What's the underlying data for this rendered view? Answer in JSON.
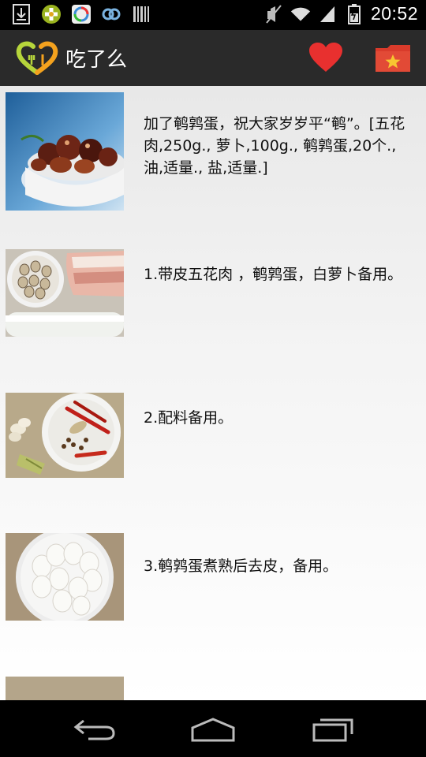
{
  "status_bar": {
    "time": "20:52",
    "icons": [
      "download-icon",
      "game-icon",
      "photos-icon",
      "link-icon",
      "barcode-icon",
      "mute-icon",
      "wifi-icon",
      "signal-icon",
      "battery-icon"
    ]
  },
  "action_bar": {
    "title": "吃了么",
    "icons": [
      "app-logo-icon",
      "heart-icon",
      "favorites-folder-icon"
    ],
    "colors": {
      "heart": "#e8302f",
      "folder": "#d93b2b",
      "star": "#f7c531"
    }
  },
  "steps": [
    {
      "text": "加了鹌鹑蛋，祝大家岁岁平“鹌”。[五花肉,250g., 萝卜,100g., 鹌鹑蛋,20个., 油,适量., 盐,适量.]",
      "image": "braised-pork-with-quail-eggs"
    },
    {
      "text": "1.带皮五花肉 ，鹌鹑蛋，白萝卜备用。",
      "image": "raw-pork-quail-eggs-radish"
    },
    {
      "text": "2.配料备用。",
      "image": "spices-on-plate"
    },
    {
      "text": "3.鹌鹑蛋煮熟后去皮，备用。",
      "image": "peeled-quail-eggs"
    }
  ],
  "nav_bar": {
    "icons": [
      "back-icon",
      "home-icon",
      "recent-apps-icon"
    ]
  }
}
